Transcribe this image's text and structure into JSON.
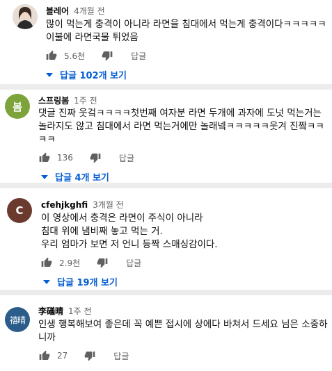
{
  "colors": {
    "accent": "#065fd4",
    "divider": "#ececec",
    "avatar_bom": "#7ca43a",
    "avatar_c": "#6b3a2e",
    "avatar_lee": "#2b5d8a"
  },
  "comments": [
    {
      "author": "블레어",
      "time": "4개월 전",
      "avatar_text": "",
      "lines": [
        "많이 먹는게 충격이 아니라 라면을 침대에서 먹는게 충격이다ㅋㅋㅋㅋㅋ",
        "이불에 라면국물 튀었음"
      ],
      "likes": "5.6천",
      "reply_label": "답글",
      "view_replies": "답글 102개 보기"
    },
    {
      "author": "스프링봄",
      "time": "1주 전",
      "avatar_text": "봄",
      "lines": [
        "댓글 진짜 웃겈ㅋㅋㅋㅋ첫번째 여자분 라면 두개에 과자에 도넛 먹는거는",
        "놀라지도 않고 침대에서 라면 먹는거에만 놀래넼ㅋㅋㅋㅋㅋ웃겨 진짴ㅋㅋ",
        "ㅋㅋ"
      ],
      "likes": "136",
      "reply_label": "답글",
      "view_replies": "답글 4개 보기"
    },
    {
      "author": "cfehjkghfi",
      "time": "3개월 전",
      "avatar_text": "C",
      "lines": [
        "이 영상에서 충격은 라면이 주식이 아니라",
        "침대 위에 냄비째 놓고 먹는 거.",
        "우리 엄마가 보면 저 언니 등짝 스매싱감이다."
      ],
      "likes": "2.9천",
      "reply_label": "답글",
      "view_replies": "답글 19개 보기"
    },
    {
      "author": "李礒晴",
      "time": "1주 전",
      "avatar_text": "禧晴",
      "lines": [
        "인생 행복해보여 좋은데 꼭 예쁜 접시에 상에다 바쳐서 드세요 님은 소중하",
        "니까"
      ],
      "likes": "27",
      "reply_label": "답글"
    }
  ]
}
